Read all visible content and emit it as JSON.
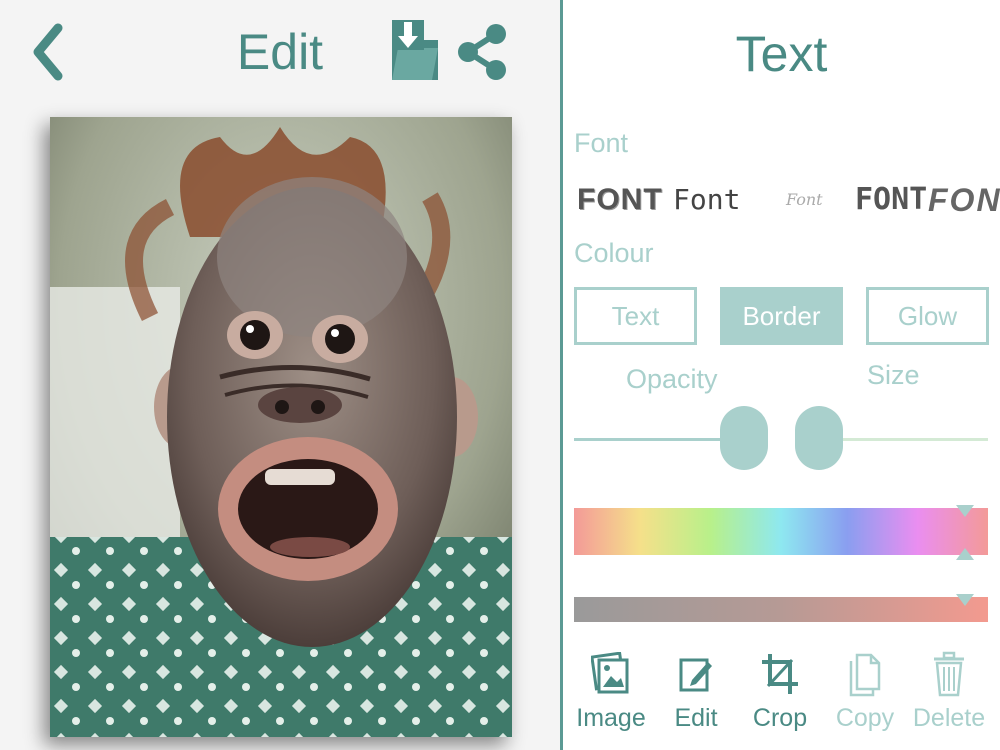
{
  "header": {
    "title": "Edit",
    "back_icon": "chevron-left-icon",
    "save_icon": "download-folder-icon",
    "share_icon": "share-icon"
  },
  "photo": {
    "subject": "baby orangutan"
  },
  "panel": {
    "title": "Text",
    "font_label": "Font",
    "font_options": [
      "FONT",
      "Font",
      "Font",
      "FONT",
      "FONT"
    ],
    "colour_label": "Colour",
    "colour_tabs": [
      {
        "label": "Text",
        "active": false
      },
      {
        "label": "Border",
        "active": true
      },
      {
        "label": "Glow",
        "active": false
      }
    ],
    "opacity_label": "Opacity",
    "size_label": "Size",
    "opacity_value": 0.41,
    "size_value": 0.0
  },
  "toolbar": {
    "items": [
      {
        "label": "Image",
        "icon": "image-icon",
        "enabled": true
      },
      {
        "label": "Edit",
        "icon": "pencil-icon",
        "enabled": true
      },
      {
        "label": "Crop",
        "icon": "crop-icon",
        "enabled": true
      },
      {
        "label": "Copy",
        "icon": "copy-icon",
        "enabled": false
      },
      {
        "label": "Delete",
        "icon": "trash-icon",
        "enabled": false
      }
    ]
  },
  "colors": {
    "accent": "#4a8a84",
    "accent_light": "#a9d0cc",
    "divider": "#5b9a94"
  }
}
